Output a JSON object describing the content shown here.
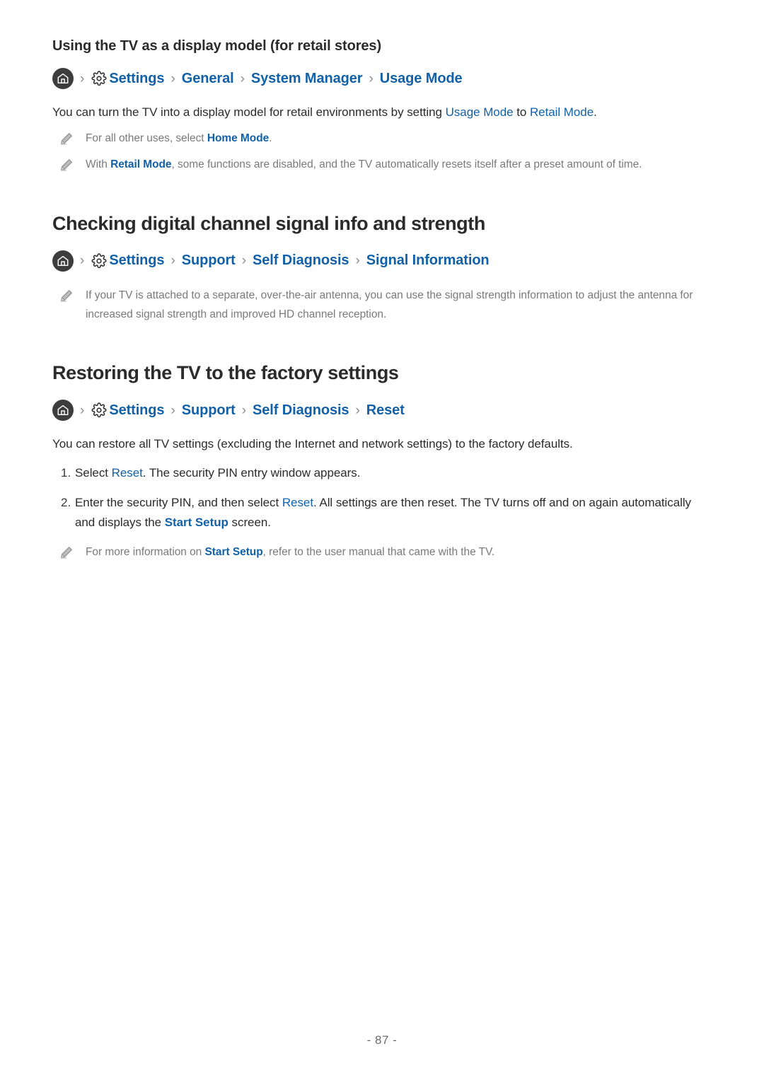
{
  "page": {
    "footer_label": "- 87 -"
  },
  "icons": {
    "home": "home-icon",
    "gear": "gear-icon",
    "pencil": "pencil-note-icon",
    "separator": "›"
  },
  "colors": {
    "link_blue": "#1261a8",
    "body_text": "#2b2b2b",
    "note_text": "#7a7a7a",
    "home_circle": "#3d3d3d",
    "separator_gray": "#8c8c8c",
    "footer_gray": "#6a6a6a"
  },
  "sections": [
    {
      "heading": "Using the TV as a display model (for retail stores)",
      "heading_level": "sub",
      "breadcrumb": [
        "Settings",
        "General",
        "System Manager",
        "Usage Mode"
      ],
      "paragraph": {
        "p1": "You can turn the TV into a display model for retail environments by setting ",
        "link1": "Usage Mode",
        "p2": " to ",
        "link2": "Retail Mode",
        "p3": "."
      },
      "notes": [
        {
          "t1": "For all other uses, select ",
          "link1": "Home Mode",
          "t2": "."
        },
        {
          "t1": "With ",
          "link1": "Retail Mode",
          "t2": ", some functions are disabled, and the TV automatically resets itself after a preset amount of time."
        }
      ]
    },
    {
      "heading": "Checking digital channel signal info and strength",
      "heading_level": "section",
      "breadcrumb": [
        "Settings",
        "Support",
        "Self Diagnosis",
        "Signal Information"
      ],
      "notes": [
        {
          "t1": "If your TV is attached to a separate, over-the-air antenna, you can use the signal strength information to adjust the antenna for increased signal strength and improved HD channel reception."
        }
      ]
    },
    {
      "heading": "Restoring the TV to the factory settings",
      "heading_level": "section",
      "breadcrumb": [
        "Settings",
        "Support",
        "Self Diagnosis",
        "Reset"
      ],
      "paragraph": {
        "full": "You can restore all TV settings (excluding the Internet and network settings) to the factory defaults."
      },
      "steps": [
        {
          "number": "1.",
          "t1": "Select ",
          "link1": "Reset",
          "t2": ". The security PIN entry window appears."
        },
        {
          "number": "2.",
          "t1": "Enter the security PIN, and then select ",
          "link1": "Reset",
          "t2": ". All settings are then reset. The TV turns off and on again automatically and displays the ",
          "link2": "Start Setup",
          "t3": " screen."
        }
      ],
      "notes": [
        {
          "t1": "For more information on ",
          "link1": "Start Setup",
          "t2": ", refer to the user manual that came with the TV."
        }
      ]
    }
  ]
}
